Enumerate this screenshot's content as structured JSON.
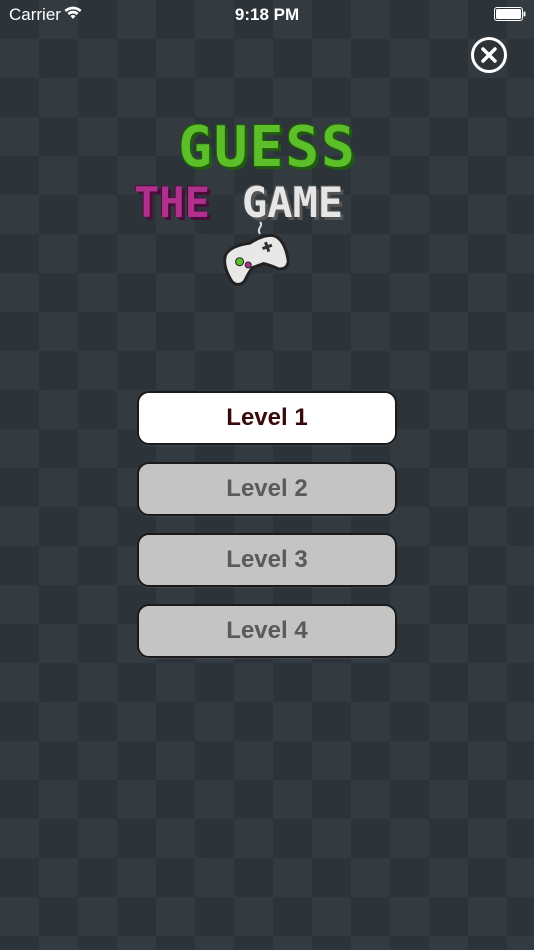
{
  "status_bar": {
    "carrier": "Carrier",
    "time": "9:18 PM",
    "icons": [
      "wifi-icon",
      "battery-icon"
    ]
  },
  "header": {
    "close_icon": "close-icon"
  },
  "logo": {
    "line1": "GUESS",
    "line2a": "THE",
    "line2b": "GAME",
    "icon": "gamepad-icon"
  },
  "levels": [
    {
      "label": "Level 1",
      "state": "unlocked"
    },
    {
      "label": "Level 2",
      "state": "locked"
    },
    {
      "label": "Level 3",
      "state": "locked"
    },
    {
      "label": "Level 4",
      "state": "locked"
    }
  ],
  "colors": {
    "background": "#2d3439",
    "logo_green": "#5cbf2a",
    "logo_magenta": "#b0308e",
    "active_button": "#ffffff",
    "locked_button": "#c4c4c4"
  }
}
